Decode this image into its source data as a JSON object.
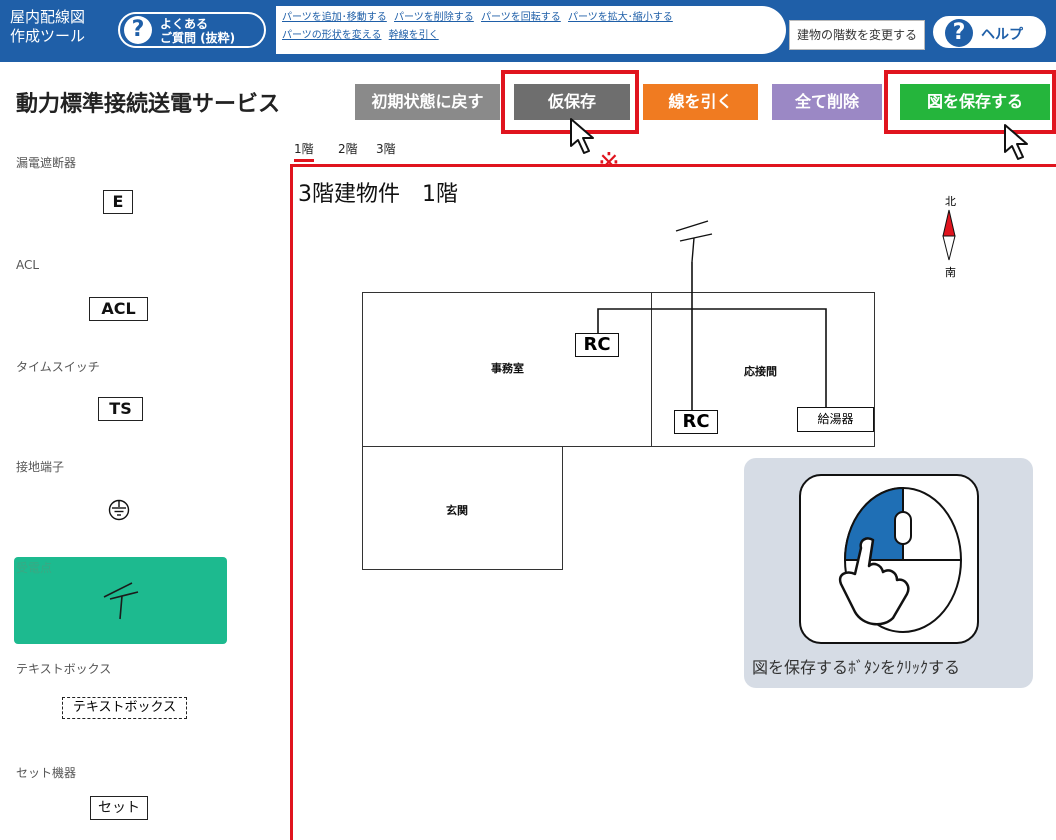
{
  "topbar": {
    "app_title_line1": "屋内配線図",
    "app_title_line2": "作成ツール",
    "faq_line1": "よくある",
    "faq_line2": "ご質問 (抜粋)",
    "faq_icon": "?",
    "links": [
      "パーツを追加･移動する",
      "パーツを削除する",
      "パーツを回転する",
      "パーツを拡大･縮小する",
      "パーツの形状を変える",
      "幹線を引く"
    ],
    "floors_button": "建物の階数を変更する",
    "help_label": "ヘルプ",
    "help_icon": "?"
  },
  "header": {
    "service_title": "動力標準接続送電サービス",
    "buttons": {
      "reset": "初期状態に戻す",
      "temp_save": "仮保存",
      "draw_line": "線を引く",
      "delete_all": "全て削除",
      "save_drawing": "図を保存する"
    },
    "note_mark": "※"
  },
  "floor_tabs": [
    "1階",
    "2階",
    "3階"
  ],
  "sidebar": {
    "categories": [
      {
        "label": "漏電遮断器",
        "part": "E"
      },
      {
        "label": "ACL",
        "part": "ACL"
      },
      {
        "label": "タイムスイッチ",
        "part": "TS"
      },
      {
        "label": "接地端子",
        "part": "ground-terminal-icon"
      },
      {
        "label": "受電点",
        "part": "service-entrance-icon"
      },
      {
        "label": "テキストボックス",
        "part": "テキストボックス"
      },
      {
        "label": "セット機器",
        "part": "セット"
      }
    ]
  },
  "canvas": {
    "title": "3階建物件　1階",
    "compass_north": "北",
    "compass_south": "南",
    "rooms": [
      "事務室",
      "応接間",
      "玄関"
    ],
    "rc_label": "RC",
    "heater_label": "給湯器"
  },
  "help_card": {
    "caption": "図を保存するﾎﾞﾀﾝをｸﾘｯｸする",
    "icon": "mouse-click-icon"
  },
  "colors": {
    "topbar": "#1f5fa8",
    "highlight": "#e0141e",
    "save": "#25b53c",
    "draw_line": "#f07b21",
    "delete_all": "#9b88c5",
    "selected_part": "#1dba8f"
  }
}
